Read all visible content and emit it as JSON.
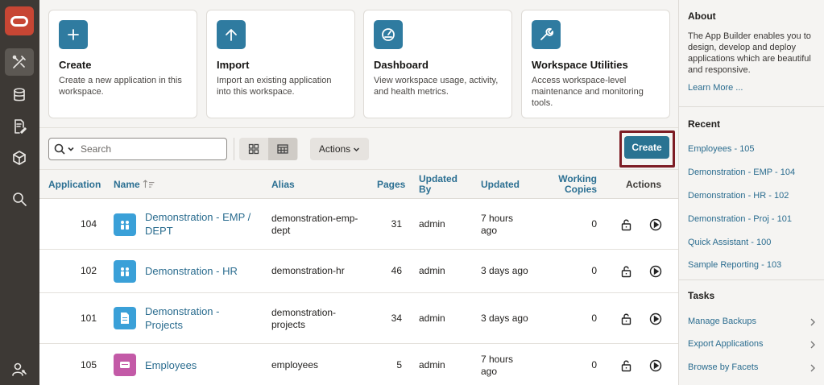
{
  "cards": [
    {
      "title": "Create",
      "desc": "Create a new application in this workspace.",
      "icon": "plus-icon"
    },
    {
      "title": "Import",
      "desc": "Import an existing application into this workspace.",
      "icon": "upload-arrow-icon"
    },
    {
      "title": "Dashboard",
      "desc": "View workspace usage, activity, and health metrics.",
      "icon": "speedometer-icon"
    },
    {
      "title": "Workspace Utilities",
      "desc": "Access workspace-level maintenance and monitoring tools.",
      "icon": "wrench-icon"
    }
  ],
  "toolbar": {
    "search_placeholder": "Search",
    "actions_label": "Actions",
    "create_label": "Create"
  },
  "table": {
    "headers": {
      "application": "Application",
      "name": "Name",
      "alias": "Alias",
      "pages": "Pages",
      "updated_by": "Updated By",
      "updated": "Updated",
      "working_copies": "Working Copies",
      "actions": "Actions"
    },
    "rows": [
      {
        "id": "104",
        "name": "Demonstration - EMP / DEPT",
        "alias": "demonstration-emp-dept",
        "pages": "31",
        "updated_by": "admin",
        "updated": "7 hours ago",
        "copies": "0",
        "icon_color": "#3aa0d8"
      },
      {
        "id": "102",
        "name": "Demonstration - HR",
        "alias": "demonstration-hr",
        "pages": "46",
        "updated_by": "admin",
        "updated": "3 days ago",
        "copies": "0",
        "icon_color": "#3aa0d8"
      },
      {
        "id": "101",
        "name": "Demonstration - Projects",
        "alias": "demonstration-projects",
        "pages": "34",
        "updated_by": "admin",
        "updated": "3 days ago",
        "copies": "0",
        "icon_color": "#3aa0d8"
      },
      {
        "id": "105",
        "name": "Employees",
        "alias": "employees",
        "pages": "5",
        "updated_by": "admin",
        "updated": "7 hours ago",
        "copies": "0",
        "icon_color": "#c35aa7"
      }
    ]
  },
  "about": {
    "title": "About",
    "text": "The App Builder enables you to design, develop and deploy applications which are beautiful and responsive.",
    "link": "Learn More ..."
  },
  "recent": {
    "title": "Recent",
    "items": [
      "Employees - 105",
      "Demonstration - EMP - 104",
      "Demonstration - HR - 102",
      "Demonstration - Proj - 101",
      "Quick Assistant - 100",
      "Sample Reporting - 103"
    ]
  },
  "tasks": {
    "title": "Tasks",
    "items": [
      "Manage Backups",
      "Export Applications",
      "Browse by Facets"
    ]
  },
  "colors": {
    "accent": "#2a7392",
    "brand": "#c74634",
    "link": "#2a6c8f",
    "highlight": "#7d1c24"
  }
}
